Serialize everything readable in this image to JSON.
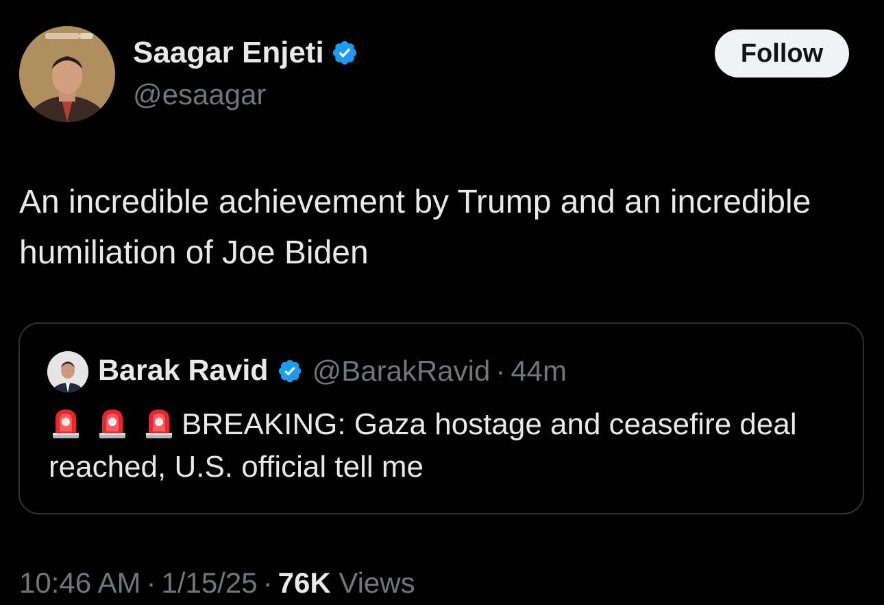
{
  "author": {
    "name": "Saagar Enjeti",
    "handle": "@esaagar",
    "verified": true
  },
  "follow_button": {
    "label": "Follow"
  },
  "tweet": {
    "text": "An incredible achievement by Trump and an incredible humiliation of Joe Biden"
  },
  "quote": {
    "name": "Barak Ravid",
    "handle": "@BarakRavid",
    "separator": "·",
    "time": "44m",
    "text": "BREAKING: Gaza hostage and ceasefire deal reached, U.S. official tell me",
    "leading_icons": [
      "siren-icon",
      "siren-icon",
      "siren-icon"
    ]
  },
  "meta": {
    "time": "10:46 AM",
    "date": "1/15/25",
    "separator": "·",
    "views_count": "76K",
    "views_label": "Views"
  },
  "colors": {
    "background": "#000000",
    "primary_text": "#e7e9ea",
    "secondary_text": "#71767b",
    "verified_blue": "#1d9bf0",
    "follow_bg": "#eff3f4",
    "card_border": "#2f3336"
  }
}
